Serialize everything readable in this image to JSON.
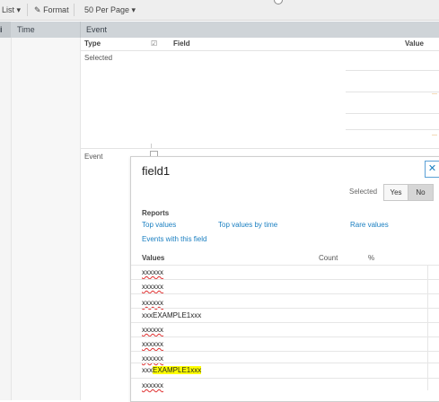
{
  "toolbar": {
    "list_label": "List ▾",
    "format_label": "Format",
    "per_page_label": "50 Per Page ▾"
  },
  "table_header": {
    "info_icon": "i",
    "time": "Time",
    "event": "Event"
  },
  "field_header": {
    "type": "Type",
    "field": "Field",
    "value": "Value"
  },
  "sections": {
    "selected": "Selected",
    "event": "Event"
  },
  "popup": {
    "title": "field1",
    "selected_label": "Selected",
    "yes": "Yes",
    "no": "No",
    "reports_label": "Reports",
    "links": {
      "top_values": "Top values",
      "top_values_by_time": "Top values by time",
      "rare_values": "Rare values",
      "events_with_field": "Events with this field"
    },
    "columns": {
      "values": "Values",
      "count": "Count",
      "percent": "%"
    },
    "values": [
      "xxxxxx",
      "xxxxxx",
      "xxxxxx",
      "xxxEXAMPLE1xxx",
      "xxxxxx",
      "xxxxxx",
      "xxxxxx",
      "xxx",
      "xxxxxx"
    ],
    "highlight_row": {
      "prefix": "xxx",
      "highlight": "EXAMPLE1xxx"
    },
    "highlight_color": "#ffff00"
  },
  "accent_color": "#1a7fc1"
}
